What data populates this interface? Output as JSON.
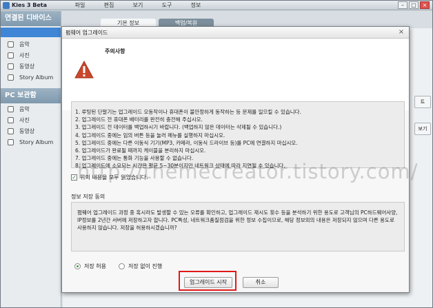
{
  "app": {
    "title": "Kies 3 Beta",
    "menu": [
      "파일",
      "편집",
      "보기",
      "도구",
      "정보"
    ]
  },
  "sidebar": {
    "connected_title": "연결된 디바이스",
    "connected_items": [
      {
        "label": "음악",
        "icon": "music-icon"
      },
      {
        "label": "사진",
        "icon": "photo-icon"
      },
      {
        "label": "동영상",
        "icon": "video-icon"
      },
      {
        "label": "Story Album",
        "icon": "album-icon"
      }
    ],
    "pc_title": "PC 보관함",
    "pc_items": [
      {
        "label": "음악",
        "icon": "music-icon"
      },
      {
        "label": "사진",
        "icon": "photo-icon"
      },
      {
        "label": "동영상",
        "icon": "video-icon"
      },
      {
        "label": "Story Album",
        "icon": "album-icon"
      }
    ]
  },
  "tabs": [
    "기본 정보",
    "백업/복원"
  ],
  "right_buttons": {
    "b1": "트",
    "b2": "보기"
  },
  "dialog": {
    "title": "펌웨어 업그레이드",
    "warning_label": "주의사항",
    "notices": [
      "1. 루팅된 단말기는 업그레이드 오동작이나 휴대폰이 불안정하게 동작하는 등 문제를 일으킬 수 있습니다.",
      "2. 업그레이드 전 휴대폰 배터리를 완전히 충전해 주십시오.",
      "3. 업그레이드 전 데이터를 백업하시기 바랍니다. (백업하지 않은 데이터는 삭제될 수 있습니다.)",
      "4. 업그레이드 중에는 임의 버튼 등을 눌러 메뉴를 실행하지 마십시오.",
      "5. 업그레이드 중에는 다른 이동식 기기(MP3, 카메라, 이동식 드라이브 등)를 PC에 연결하지 마십시오.",
      "6. 업그레이드가 완료될 때까지 케이블을 분리하지 마십시오.",
      "7. 업그레이드 중에는 통화 기능을 사용할 수 없습니다.",
      "8. 업그레이드에 소요되는 시간은 평균 5~30분이지만 네트워크 상태에 따라 지연될 수 있습니다."
    ],
    "agree_label": "위의 내용을 모두 읽었습니다.",
    "consent_title": "정보 저장 동의",
    "consent_text": "펌웨어 업그레이드 과정 중 혹시라도 발생할 수 있는 오류를 확인하고, 업그레이드 재시도 횟수 등을 분석하기 위한 용도로 고객님의 PC하드웨어사양, IP정보를 2년간 서버에 저장하고자 합니다. PC특성, 네트워크품질점검을 위한 정보 수집이므로, 해당 정보외의 내용은 저장되지 않으며 다른 용도로 사용하지 않습니다. 저장을 허용하시겠습니까?",
    "radio_allow": "저장 허용",
    "radio_deny": "저장 없이 진행",
    "start_button": "업그레이드 시작",
    "cancel_button": "취소"
  },
  "watermark": "http://themecreator.tistory.com/"
}
